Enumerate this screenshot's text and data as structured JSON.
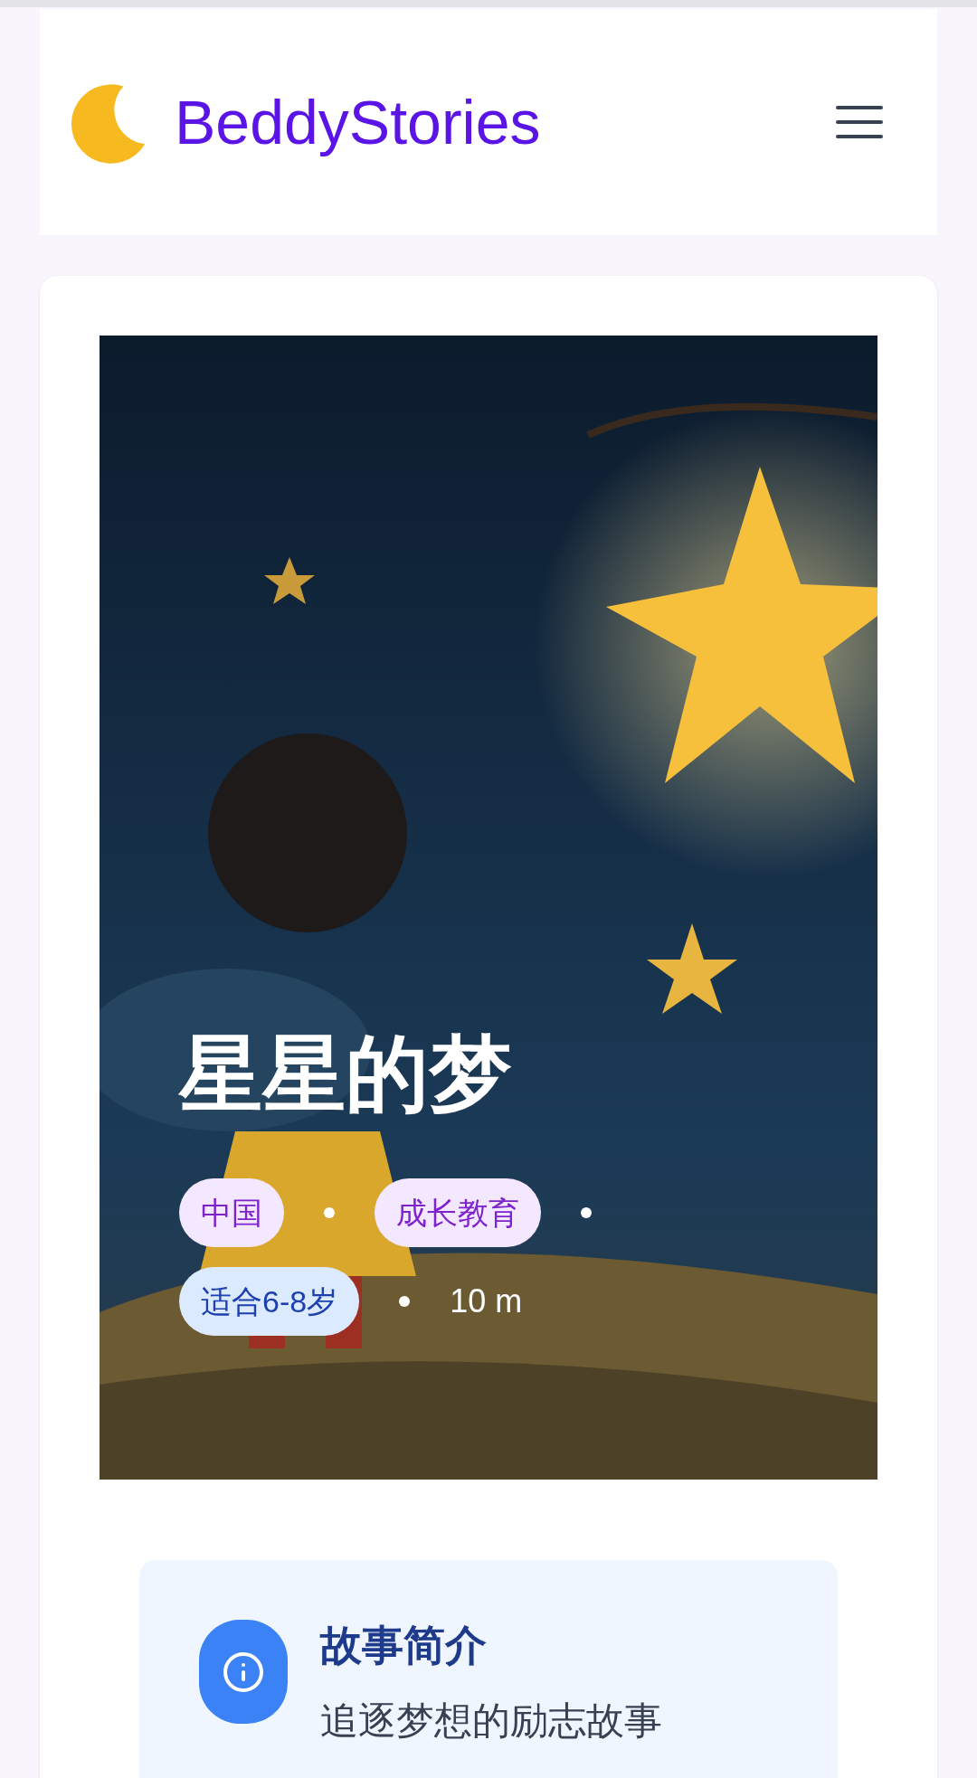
{
  "header": {
    "logo_text": "BeddyStories"
  },
  "story": {
    "title": "星星的梦",
    "meta": [
      {
        "text": "中国",
        "kind": "category"
      },
      {
        "text": "成长教育",
        "kind": "category"
      },
      {
        "text": "适合6-8岁",
        "kind": "age"
      },
      {
        "text": "10 m",
        "kind": "duration"
      }
    ]
  },
  "summary": {
    "heading": "故事简介",
    "text": "追逐梦想的励志故事"
  }
}
